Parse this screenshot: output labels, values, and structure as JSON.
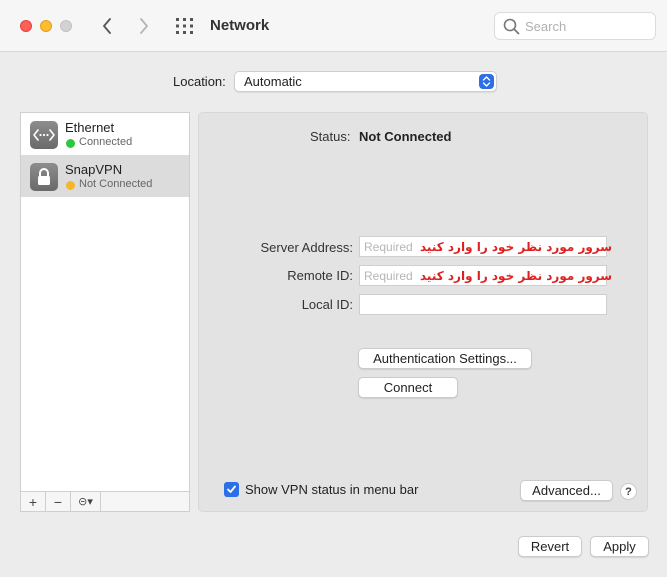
{
  "window": {
    "title": "Network",
    "search_placeholder": "Search"
  },
  "location": {
    "label": "Location:",
    "value": "Automatic"
  },
  "services": [
    {
      "name": "Ethernet",
      "status": "Connected",
      "status_color": "#2ec840",
      "icon": "ethernet-icon"
    },
    {
      "name": "SnapVPN",
      "status": "Not Connected",
      "status_color": "#f6b62a",
      "icon": "lock-icon"
    }
  ],
  "sidebar_tools": {
    "add": "+",
    "remove": "−",
    "more": "⊝▾"
  },
  "detail": {
    "status_label": "Status:",
    "status_value": "Not Connected",
    "server_address_label": "Server Address:",
    "remote_id_label": "Remote ID:",
    "local_id_label": "Local ID:",
    "required_placeholder": "Required",
    "overlay_text": "سرور مورد نظر خود را وارد کنید",
    "auth_button": "Authentication Settings...",
    "connect_button": "Connect",
    "show_status_label": "Show VPN status in menu bar",
    "show_status_checked": true,
    "advanced_button": "Advanced...",
    "help": "?"
  },
  "footer": {
    "revert": "Revert",
    "apply": "Apply"
  },
  "colors": {
    "accent": "#2c6fe8",
    "overlay_text": "#e02020"
  }
}
